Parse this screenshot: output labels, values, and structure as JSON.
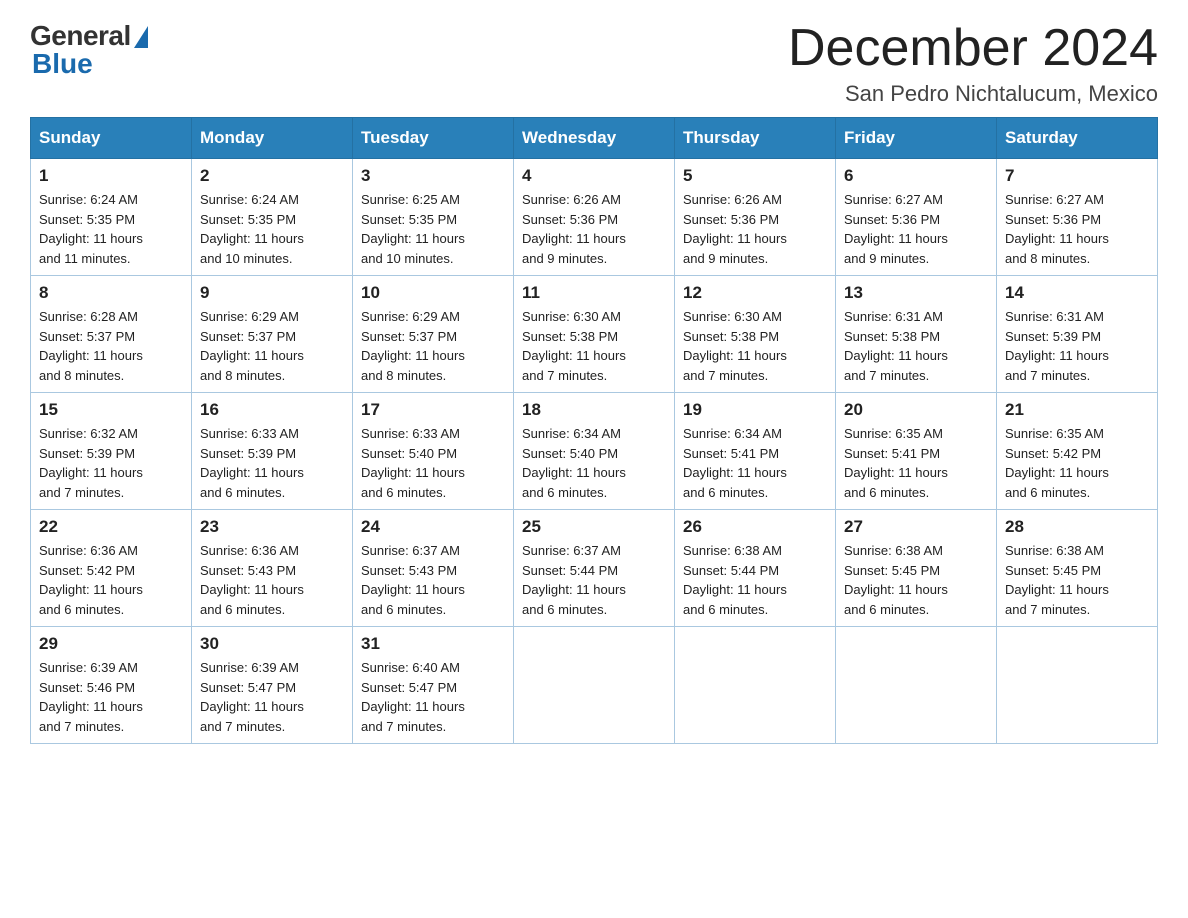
{
  "logo": {
    "general": "General",
    "blue": "Blue"
  },
  "title": "December 2024",
  "subtitle": "San Pedro Nichtalucum, Mexico",
  "headers": [
    "Sunday",
    "Monday",
    "Tuesday",
    "Wednesday",
    "Thursday",
    "Friday",
    "Saturday"
  ],
  "weeks": [
    [
      {
        "day": "1",
        "info": "Sunrise: 6:24 AM\nSunset: 5:35 PM\nDaylight: 11 hours\nand 11 minutes."
      },
      {
        "day": "2",
        "info": "Sunrise: 6:24 AM\nSunset: 5:35 PM\nDaylight: 11 hours\nand 10 minutes."
      },
      {
        "day": "3",
        "info": "Sunrise: 6:25 AM\nSunset: 5:35 PM\nDaylight: 11 hours\nand 10 minutes."
      },
      {
        "day": "4",
        "info": "Sunrise: 6:26 AM\nSunset: 5:36 PM\nDaylight: 11 hours\nand 9 minutes."
      },
      {
        "day": "5",
        "info": "Sunrise: 6:26 AM\nSunset: 5:36 PM\nDaylight: 11 hours\nand 9 minutes."
      },
      {
        "day": "6",
        "info": "Sunrise: 6:27 AM\nSunset: 5:36 PM\nDaylight: 11 hours\nand 9 minutes."
      },
      {
        "day": "7",
        "info": "Sunrise: 6:27 AM\nSunset: 5:36 PM\nDaylight: 11 hours\nand 8 minutes."
      }
    ],
    [
      {
        "day": "8",
        "info": "Sunrise: 6:28 AM\nSunset: 5:37 PM\nDaylight: 11 hours\nand 8 minutes."
      },
      {
        "day": "9",
        "info": "Sunrise: 6:29 AM\nSunset: 5:37 PM\nDaylight: 11 hours\nand 8 minutes."
      },
      {
        "day": "10",
        "info": "Sunrise: 6:29 AM\nSunset: 5:37 PM\nDaylight: 11 hours\nand 8 minutes."
      },
      {
        "day": "11",
        "info": "Sunrise: 6:30 AM\nSunset: 5:38 PM\nDaylight: 11 hours\nand 7 minutes."
      },
      {
        "day": "12",
        "info": "Sunrise: 6:30 AM\nSunset: 5:38 PM\nDaylight: 11 hours\nand 7 minutes."
      },
      {
        "day": "13",
        "info": "Sunrise: 6:31 AM\nSunset: 5:38 PM\nDaylight: 11 hours\nand 7 minutes."
      },
      {
        "day": "14",
        "info": "Sunrise: 6:31 AM\nSunset: 5:39 PM\nDaylight: 11 hours\nand 7 minutes."
      }
    ],
    [
      {
        "day": "15",
        "info": "Sunrise: 6:32 AM\nSunset: 5:39 PM\nDaylight: 11 hours\nand 7 minutes."
      },
      {
        "day": "16",
        "info": "Sunrise: 6:33 AM\nSunset: 5:39 PM\nDaylight: 11 hours\nand 6 minutes."
      },
      {
        "day": "17",
        "info": "Sunrise: 6:33 AM\nSunset: 5:40 PM\nDaylight: 11 hours\nand 6 minutes."
      },
      {
        "day": "18",
        "info": "Sunrise: 6:34 AM\nSunset: 5:40 PM\nDaylight: 11 hours\nand 6 minutes."
      },
      {
        "day": "19",
        "info": "Sunrise: 6:34 AM\nSunset: 5:41 PM\nDaylight: 11 hours\nand 6 minutes."
      },
      {
        "day": "20",
        "info": "Sunrise: 6:35 AM\nSunset: 5:41 PM\nDaylight: 11 hours\nand 6 minutes."
      },
      {
        "day": "21",
        "info": "Sunrise: 6:35 AM\nSunset: 5:42 PM\nDaylight: 11 hours\nand 6 minutes."
      }
    ],
    [
      {
        "day": "22",
        "info": "Sunrise: 6:36 AM\nSunset: 5:42 PM\nDaylight: 11 hours\nand 6 minutes."
      },
      {
        "day": "23",
        "info": "Sunrise: 6:36 AM\nSunset: 5:43 PM\nDaylight: 11 hours\nand 6 minutes."
      },
      {
        "day": "24",
        "info": "Sunrise: 6:37 AM\nSunset: 5:43 PM\nDaylight: 11 hours\nand 6 minutes."
      },
      {
        "day": "25",
        "info": "Sunrise: 6:37 AM\nSunset: 5:44 PM\nDaylight: 11 hours\nand 6 minutes."
      },
      {
        "day": "26",
        "info": "Sunrise: 6:38 AM\nSunset: 5:44 PM\nDaylight: 11 hours\nand 6 minutes."
      },
      {
        "day": "27",
        "info": "Sunrise: 6:38 AM\nSunset: 5:45 PM\nDaylight: 11 hours\nand 6 minutes."
      },
      {
        "day": "28",
        "info": "Sunrise: 6:38 AM\nSunset: 5:45 PM\nDaylight: 11 hours\nand 7 minutes."
      }
    ],
    [
      {
        "day": "29",
        "info": "Sunrise: 6:39 AM\nSunset: 5:46 PM\nDaylight: 11 hours\nand 7 minutes."
      },
      {
        "day": "30",
        "info": "Sunrise: 6:39 AM\nSunset: 5:47 PM\nDaylight: 11 hours\nand 7 minutes."
      },
      {
        "day": "31",
        "info": "Sunrise: 6:40 AM\nSunset: 5:47 PM\nDaylight: 11 hours\nand 7 minutes."
      },
      {
        "day": "",
        "info": ""
      },
      {
        "day": "",
        "info": ""
      },
      {
        "day": "",
        "info": ""
      },
      {
        "day": "",
        "info": ""
      }
    ]
  ]
}
